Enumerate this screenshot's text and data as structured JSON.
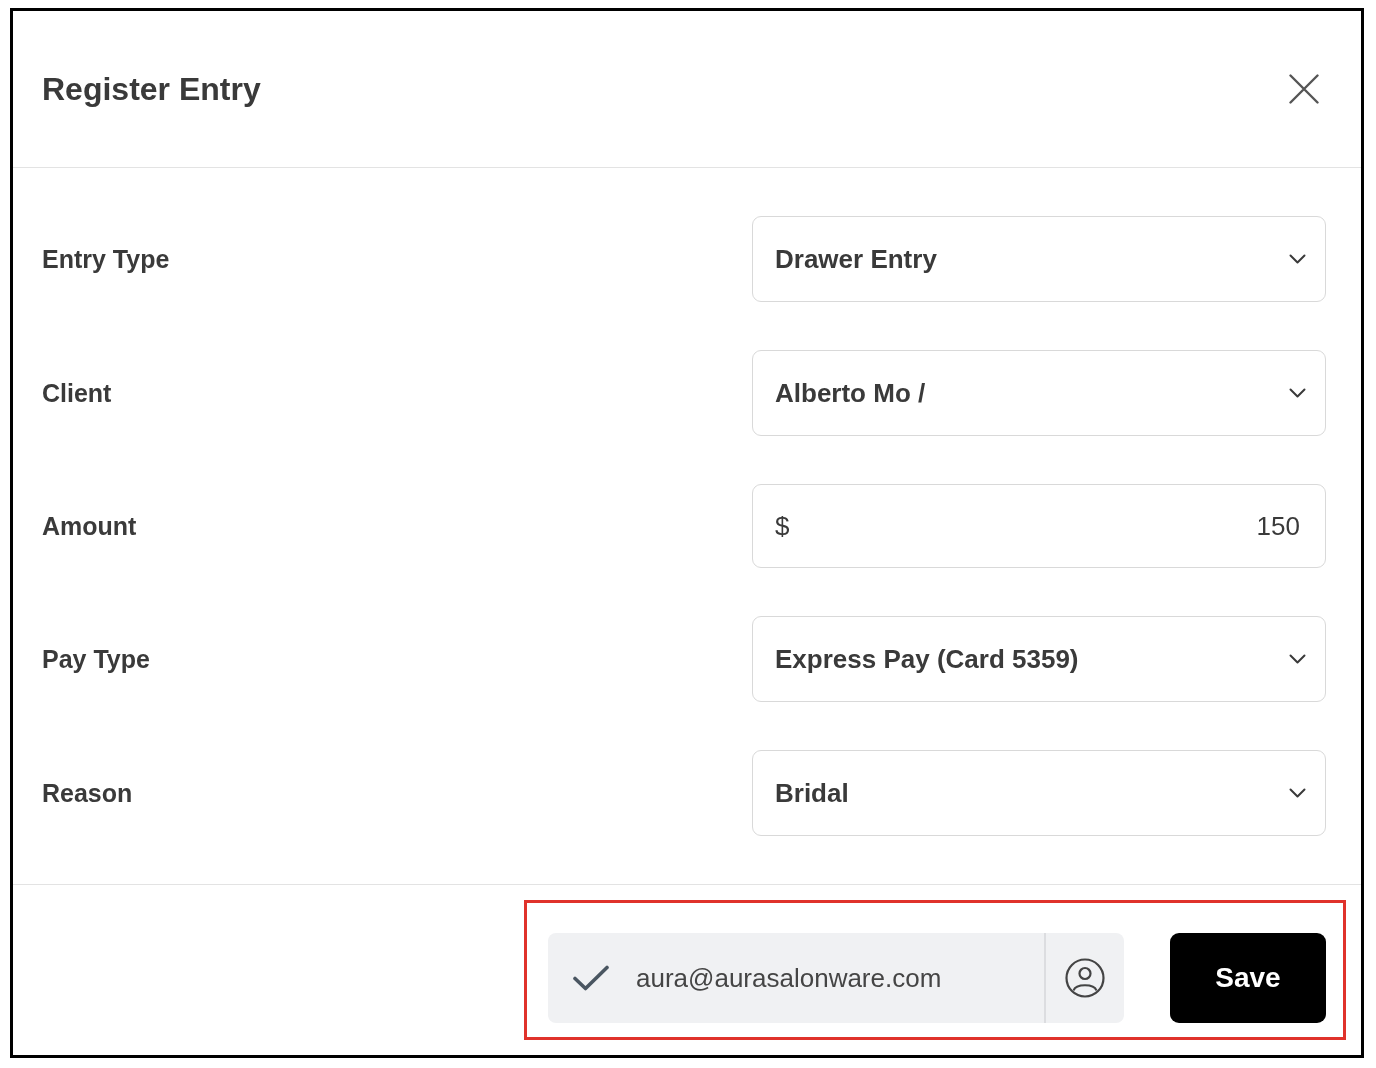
{
  "dialog": {
    "title": "Register Entry"
  },
  "fields": [
    {
      "label": "Entry Type",
      "kind": "select",
      "value": "Drawer Entry"
    },
    {
      "label": "Client",
      "kind": "select",
      "value": "Alberto Mo /"
    },
    {
      "label": "Amount",
      "kind": "currency",
      "prefix": "$",
      "value": "150"
    },
    {
      "label": "Pay Type",
      "kind": "select",
      "value": "Express Pay (Card 5359)"
    },
    {
      "label": "Reason",
      "kind": "select",
      "value": "Bridal"
    }
  ],
  "footer": {
    "user": {
      "verified": true,
      "email": "aura@aurasalonware.com"
    },
    "save_button": "Save"
  }
}
